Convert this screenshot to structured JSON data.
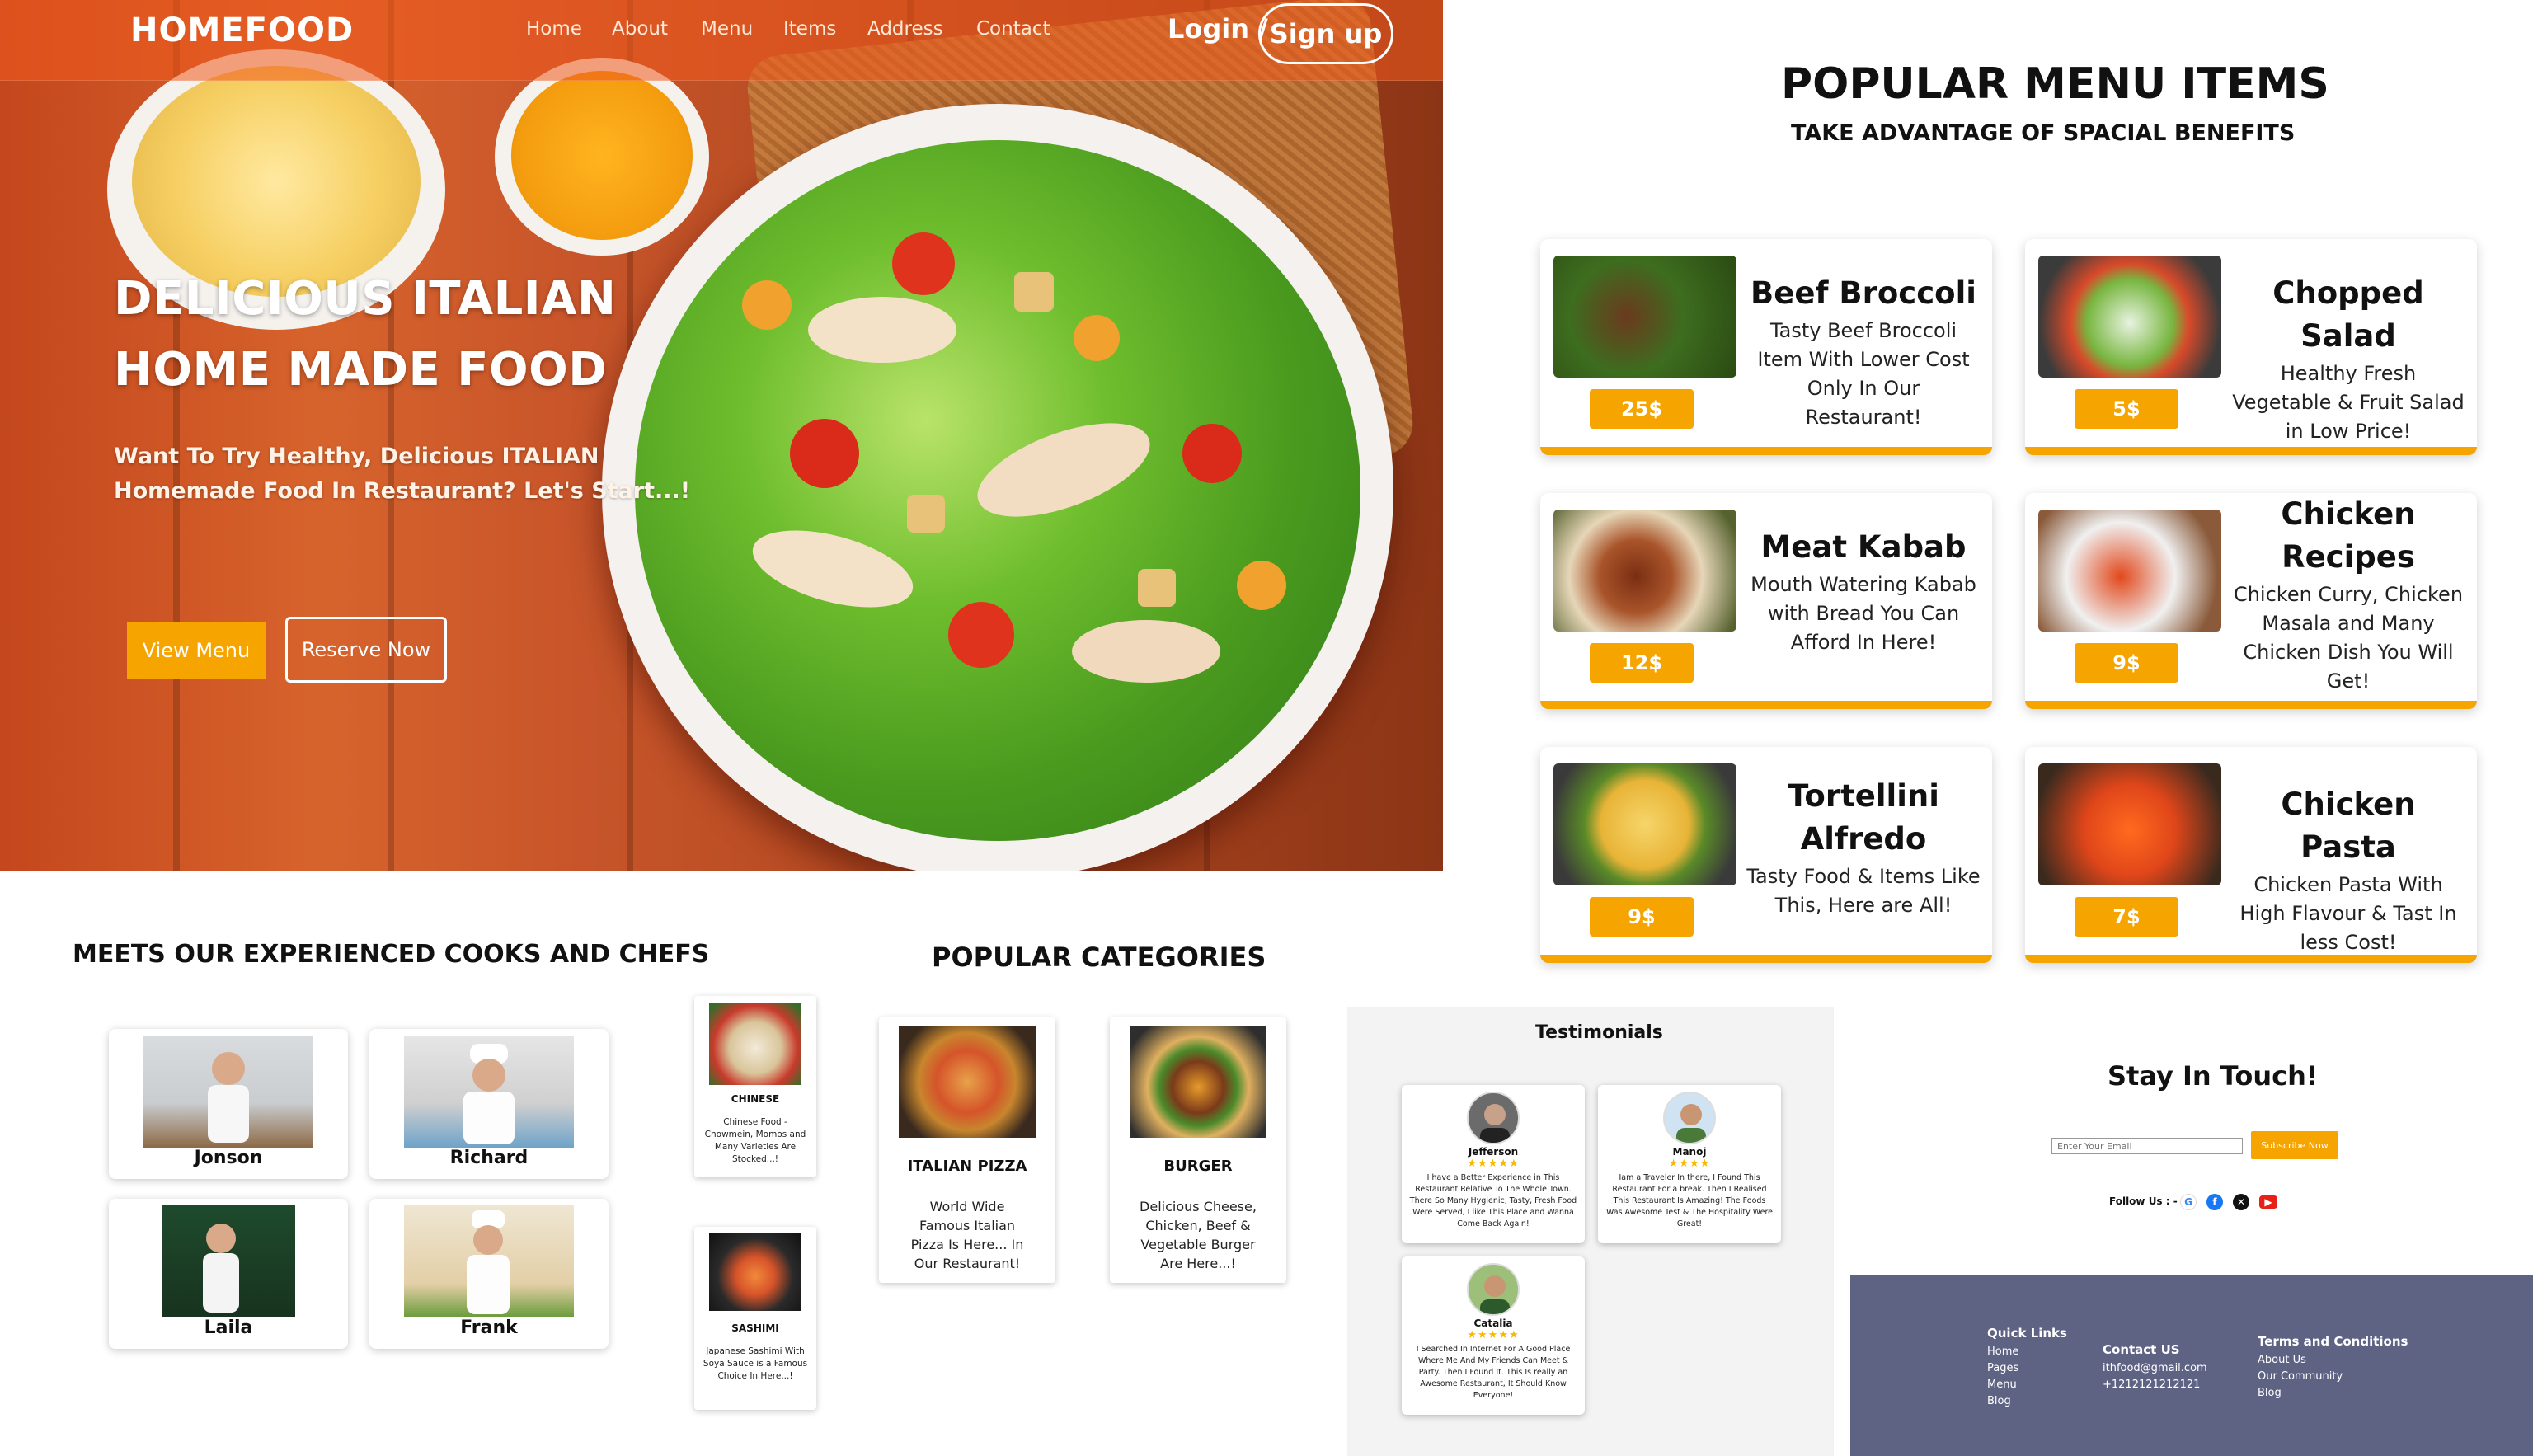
{
  "header": {
    "logo": "HOMEFOOD",
    "nav": [
      "Home",
      "About",
      "Menu",
      "Items",
      "Address",
      "Contact"
    ],
    "login": "Login /",
    "signup": "Sign up"
  },
  "hero": {
    "title_line1": "DELICIOUS ITALIAN",
    "title_line2": "HOME MADE FOOD",
    "subtitle_line1": "Want To Try Healthy, Delicious ITALIAN",
    "subtitle_line2": "Homemade Food In Restaurant? Let's Start...!",
    "view_menu": "View Menu",
    "reserve_now": "Reserve Now"
  },
  "menu": {
    "title": "POPULAR MENU ITEMS",
    "subtitle": "TAKE ADVANTAGE OF SPACIAL BENEFITS",
    "items": [
      {
        "name": "Beef Broccoli",
        "desc": "Tasty Beef Broccoli Item With Lower Cost Only In Our Restaurant!",
        "price": "25$"
      },
      {
        "name": "Chopped Salad",
        "desc": "Healthy Fresh Vegetable & Fruit Salad in Low Price!",
        "price": "5$"
      },
      {
        "name": "Meat Kabab",
        "desc": "Mouth Watering Kabab with Bread You Can Afford In Here!",
        "price": "12$"
      },
      {
        "name": "Chicken Recipes",
        "desc": "Chicken Curry, Chicken Masala and Many Chicken Dish You Will Get!",
        "price": "9$"
      },
      {
        "name": "Tortellini Alfredo",
        "desc": "Tasty Food & Items Like This, Here are All!",
        "price": "9$"
      },
      {
        "name": "Chicken Pasta",
        "desc": "Chicken Pasta With High Flavour & Tast In less Cost!",
        "price": "7$"
      }
    ]
  },
  "chefs": {
    "title": "MEETS OUR EXPERIENCED COOKS AND CHEFS",
    "names": [
      "Jonson",
      "Richard",
      "Laila",
      "Frank"
    ]
  },
  "categories": {
    "title": "POPULAR CATEGORIES",
    "items": [
      {
        "name": "CHINESE",
        "desc": "Chinese Food - Chowmein, Momos and Many Varieties Are Stocked...!"
      },
      {
        "name": "SASHIMI",
        "desc": "Japanese Sashimi With Soya Sauce is a Famous Choice In Here...!"
      },
      {
        "name": "ITALIAN PIZZA",
        "desc": "World Wide Famous Italian Pizza Is Here... In Our Restaurant!"
      },
      {
        "name": "BURGER",
        "desc": "Delicious Cheese, Chicken, Beef & Vegetable Burger Are Here...!"
      }
    ]
  },
  "testimonials": {
    "title": "Testimonials",
    "items": [
      {
        "name": "Jefferson",
        "stars": "★★★★★",
        "text": "I have a Better Experience in This Restaurant Relative To The Whole Town. There So Many Hygienic, Tasty, Fresh Food Were Served, I like This Place and Wanna Come Back Again!"
      },
      {
        "name": "Manoj",
        "stars": "★★★★",
        "text": "Iam a Traveler In there, I Found This Restaurant For a break. Then I Realised This Restaurant Is Amazing! The Foods Was Awesome Test & The Hospitality Were Great!"
      },
      {
        "name": "Catalia",
        "stars": "★★★★★",
        "text": "I Searched In Internet For A Good Place Where Me And My Friends Can Meet & Party. Then I Found It. This Is really an Awesome Restaurant, It Should Know Everyone!"
      }
    ]
  },
  "newsletter": {
    "title": "Stay In Touch!",
    "email_placeholder": "Enter Your Email",
    "subscribe": "Subscribe Now",
    "follow": "Follow Us : -",
    "socials": [
      "google-icon",
      "facebook-icon",
      "x-icon",
      "youtube-icon"
    ]
  },
  "footer": {
    "quick_links_title": "Quick Links",
    "quick_links": [
      "Home",
      "Pages",
      "Menu",
      "Blog"
    ],
    "contact_title": "Contact US",
    "contact": [
      "ithfood@gmail.com",
      "+1212121212121"
    ],
    "terms_title": "Terms and Conditions",
    "terms": [
      "About Us",
      "Our Community",
      "Blog"
    ]
  },
  "colors": {
    "accent": "#f6a400",
    "footer_bg": "#5e6384",
    "hero_orange": "#d7632c"
  }
}
